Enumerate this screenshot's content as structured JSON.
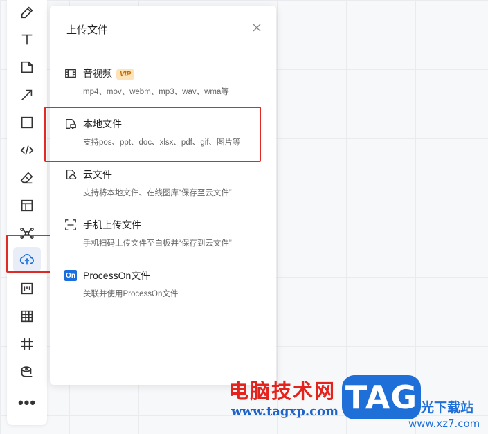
{
  "panel": {
    "title": "上传文件",
    "options": [
      {
        "title": "音视频",
        "badge": "VIP",
        "desc": "mp4、mov、webm、mp3、wav、wma等"
      },
      {
        "title": "本地文件",
        "desc": "支持pos、ppt、doc、xlsx、pdf、gif、图片等"
      },
      {
        "title": "云文件",
        "desc": "支持将本地文件、在线图库“保存至云文件”"
      },
      {
        "title": "手机上传文件",
        "desc": "手机扫码上传文件至白板并“保存到云文件”"
      },
      {
        "title": "ProcessOn文件",
        "icon_text": "On",
        "desc": "关联并使用ProcessOn文件"
      }
    ]
  },
  "toolbar": {
    "items": [
      "pen-icon",
      "text-icon",
      "note-icon",
      "arrow-icon",
      "rectangle-icon",
      "code-icon",
      "eraser-icon",
      "layout-icon",
      "mindmap-icon",
      "upload-cloud-icon",
      "kanban-icon",
      "table-icon",
      "frame-icon",
      "tape-icon",
      "more-icon"
    ],
    "active": "upload-cloud-icon"
  },
  "watermark": {
    "cn_text": "电脑技术网",
    "url": "www.tagxp.com",
    "tag": "TAG",
    "side_text": "光下载站",
    "side_url": "www.xz7.com"
  },
  "colors": {
    "highlight": "#e02a25",
    "accent": "#1a6fde",
    "vip_bg": "#ffe3b8"
  }
}
